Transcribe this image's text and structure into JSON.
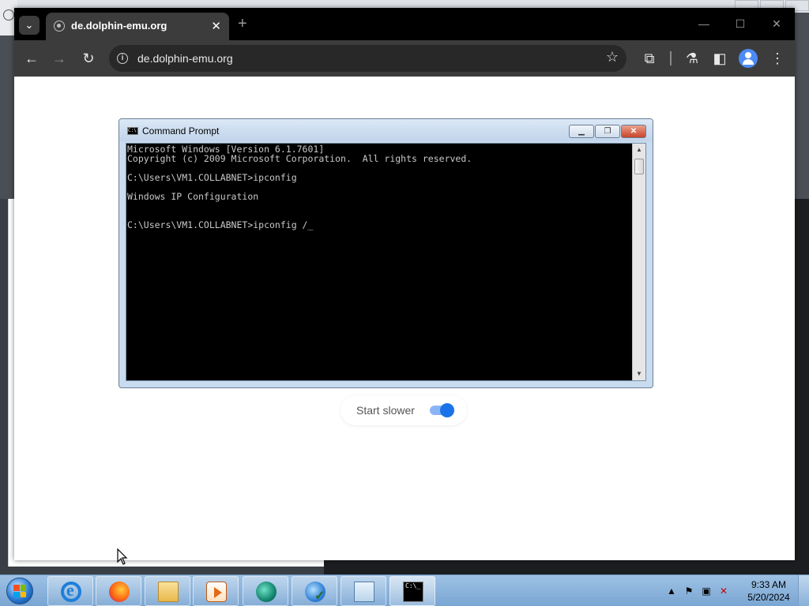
{
  "browser": {
    "tab_title": "de.dolphin-emu.org",
    "new_tab_symbol": "+",
    "close_tab_symbol": "✕",
    "url": "de.dolphin-emu.org"
  },
  "cmd_window": {
    "title": "Command Prompt",
    "lines": [
      "Microsoft Windows [Version 6.1.7601]",
      "Copyright (c) 2009 Microsoft Corporation.  All rights reserved.",
      "",
      "C:\\Users\\VM1.COLLABNET>ipconfig",
      "",
      "Windows IP Configuration",
      "",
      "",
      "C:\\Users\\VM1.COLLABNET>ipconfig /_"
    ]
  },
  "toggle": {
    "label": "Start slower",
    "checked": true,
    "accent": "#1a73e8"
  },
  "taskbar": {
    "apps": [
      "internet-explorer",
      "firefox",
      "file-explorer",
      "media-player",
      "dolphin",
      "network-check",
      "control-panel",
      "command-prompt"
    ],
    "active": "command-prompt"
  },
  "clock": {
    "time": "9:33 AM",
    "date": "5/20/2024"
  }
}
